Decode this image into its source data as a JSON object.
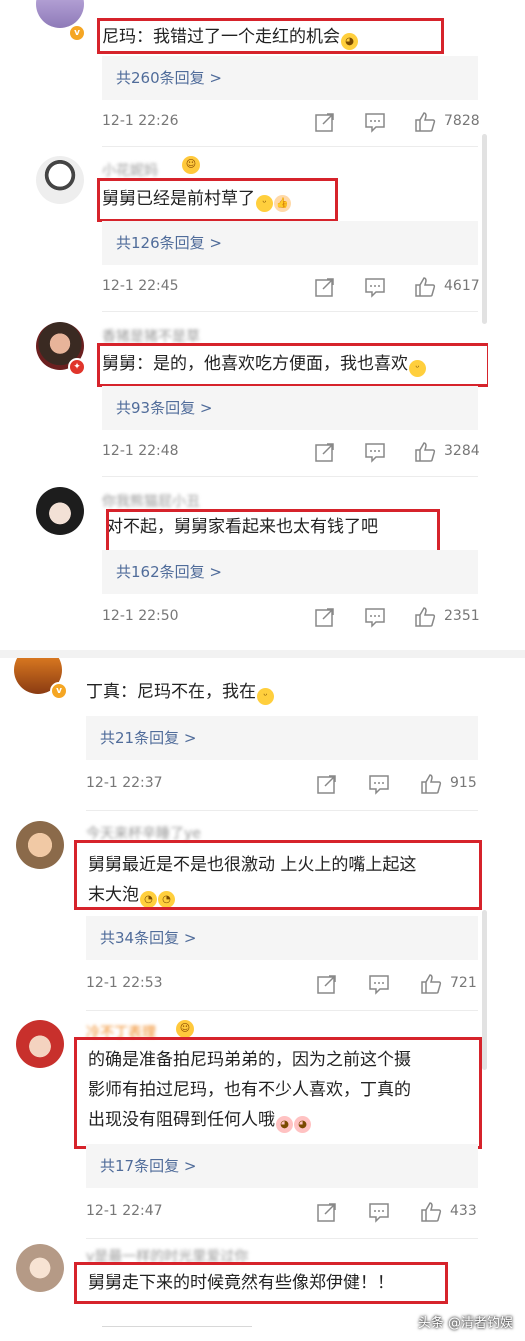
{
  "panel1": {
    "comments": [
      {
        "username": "",
        "content": "尼玛：我错过了一个走红的机会",
        "content_emoji": "cry-emoji",
        "replies": "共260条回复 >",
        "time": "12-1 22:26",
        "likes": "7828"
      },
      {
        "username": "小花妮妈",
        "content": "舅舅已经是前村草了",
        "content_emoji": "grin-thumb-emoji",
        "replies": "共126条回复 >",
        "time": "12-1 22:45",
        "likes": "4617"
      },
      {
        "username": "香猪是猪不是草",
        "content": "舅舅：是的，他喜欢吃方便面，我也喜欢",
        "content_emoji": "grin-emoji",
        "replies": "共93条回复 >",
        "time": "12-1 22:48",
        "likes": "3284"
      },
      {
        "username": "你我熊猫屁小丑",
        "content": "对不起，舅舅家看起来也太有钱了吧",
        "content_emoji": "",
        "replies": "共162条回复 >",
        "time": "12-1 22:50",
        "likes": "2351"
      }
    ]
  },
  "panel2": {
    "comments": [
      {
        "username": "",
        "content": "丁真：尼玛不在，我在",
        "content_emoji": "grin-emoji",
        "replies": "共21条回复 >",
        "time": "12-1 22:37",
        "likes": "915"
      },
      {
        "username": "今天来杯辛睡了ye",
        "content_line1": "舅舅最近是不是也很激动 上火上的嘴上起这",
        "content_line2": "末大泡",
        "content_emoji": "laugh-cry-emoji",
        "replies": "共34条回复 >",
        "time": "12-1 22:53",
        "likes": "721"
      },
      {
        "username": "冷不丁表理",
        "content_line1": "的确是准备拍尼玛弟弟的，因为之前这个摄",
        "content_line2": "影师有拍过尼玛，也有不少人喜欢，丁真的",
        "content_line3": "出现没有阻碍到任何人哦",
        "content_emoji": "blush-emoji",
        "replies": "共17条回复 >",
        "time": "12-1 22:47",
        "likes": "433"
      },
      {
        "username": "v是最一样的时光里爱过你",
        "content": "舅舅走下来的时候竟然有些像郑伊健！！",
        "content_emoji": "",
        "replies": "",
        "time": "",
        "likes": ""
      }
    ]
  },
  "watermark": "头条 @清者钓娱",
  "colors": {
    "highlight_border": "#d6232b",
    "reply_link": "#506c9a",
    "reply_bg": "#f5f5f5"
  }
}
